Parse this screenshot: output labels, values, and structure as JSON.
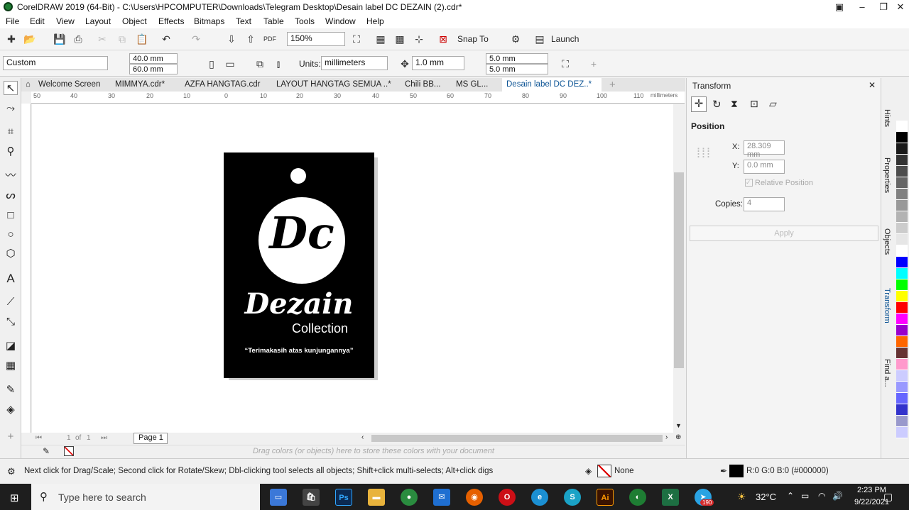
{
  "window": {
    "title": "CorelDRAW 2019 (64-Bit) - C:\\Users\\HPCOMPUTER\\Downloads\\Telegram Desktop\\Desain label DC DEZAIN (2).cdr*"
  },
  "menu": [
    "File",
    "Edit",
    "View",
    "Layout",
    "Object",
    "Effects",
    "Bitmaps",
    "Text",
    "Table",
    "Tools",
    "Window",
    "Help"
  ],
  "toolbar": {
    "zoom": "150%",
    "snap_label": "Snap To",
    "launch_label": "Launch"
  },
  "property_bar": {
    "preset": "Custom",
    "width": "40.0 mm",
    "height": "60.0 mm",
    "units_label": "Units:",
    "units": "millimeters",
    "nudge": "1.0 mm",
    "dup_x": "5.0 mm",
    "dup_y": "5.0 mm"
  },
  "tabs": [
    "Welcome Screen",
    "MIMMYA.cdr*",
    "AZFA HANGTAG.cdr",
    "LAYOUT HANGTAG SEMUA ..*",
    "Chili BB...",
    "MS GL...",
    "Desain label DC DEZ..*"
  ],
  "ruler": {
    "ticks": [
      "50",
      "40",
      "30",
      "20",
      "10",
      "0",
      "10",
      "20",
      "30",
      "40",
      "50",
      "60",
      "70",
      "80",
      "90",
      "100",
      "110"
    ],
    "unit": "millimeters"
  },
  "label": {
    "monogram": "Dc",
    "brand": "Dezain",
    "sub": "Collection",
    "tagline": "“Terimakasih atas kunjungannya”"
  },
  "pages": {
    "current": "1",
    "of": "of",
    "total": "1",
    "page_tab": "Page 1"
  },
  "palette_hint": "Drag colors (or objects) here to store these colors with your document",
  "docker": {
    "title": "Transform",
    "section": "Position",
    "x_label": "X:",
    "x": "28.309 mm",
    "y_label": "Y:",
    "y": "0.0 mm",
    "relative": "Relative Position",
    "copies_label": "Copies:",
    "copies": "4",
    "apply": "Apply"
  },
  "side_tabs": [
    "Hints",
    "Properties",
    "Objects",
    "Transform",
    "Find a..."
  ],
  "palette_colors": [
    "#ffffff",
    "#000000",
    "#1a1a1a",
    "#333333",
    "#4d4d4d",
    "#666666",
    "#808080",
    "#999999",
    "#b3b3b3",
    "#cccccc",
    "#e6e6e6",
    "#ffffff",
    "#0000ff",
    "#00ffff",
    "#00ff00",
    "#ffff00",
    "#ff0000",
    "#ff00ff",
    "#9900cc",
    "#ff6600",
    "#663333",
    "#ff99cc",
    "#ccccff",
    "#9999ff",
    "#6666ff",
    "#3333cc",
    "#9999cc",
    "#ccccff"
  ],
  "status": {
    "hint": "Next click for Drag/Scale; Second click for Rotate/Skew; Dbl-clicking tool selects all objects; Shift+click multi-selects; Alt+click digs",
    "fill": "None",
    "outline": "R:0 G:0 B:0 (#000000)"
  },
  "taskbar": {
    "search": "Type here to search",
    "temp": "32°C",
    "time": "2:23 PM",
    "date": "9/22/2021",
    "badge": "190"
  }
}
